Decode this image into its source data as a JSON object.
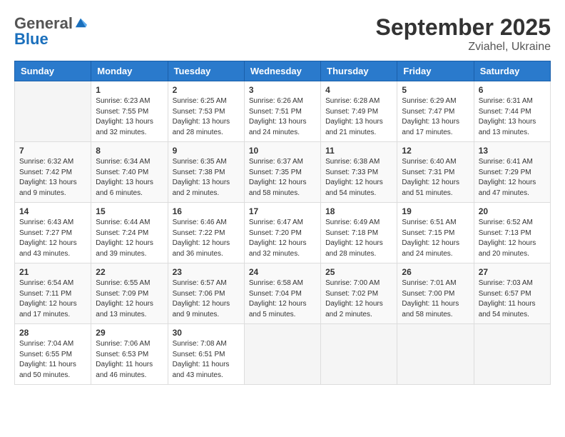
{
  "logo": {
    "general": "General",
    "blue": "Blue"
  },
  "title": "September 2025",
  "subtitle": "Zviahel, Ukraine",
  "weekdays": [
    "Sunday",
    "Monday",
    "Tuesday",
    "Wednesday",
    "Thursday",
    "Friday",
    "Saturday"
  ],
  "weeks": [
    [
      {
        "day": "",
        "info": ""
      },
      {
        "day": "1",
        "info": "Sunrise: 6:23 AM\nSunset: 7:55 PM\nDaylight: 13 hours and 32 minutes."
      },
      {
        "day": "2",
        "info": "Sunrise: 6:25 AM\nSunset: 7:53 PM\nDaylight: 13 hours and 28 minutes."
      },
      {
        "day": "3",
        "info": "Sunrise: 6:26 AM\nSunset: 7:51 PM\nDaylight: 13 hours and 24 minutes."
      },
      {
        "day": "4",
        "info": "Sunrise: 6:28 AM\nSunset: 7:49 PM\nDaylight: 13 hours and 21 minutes."
      },
      {
        "day": "5",
        "info": "Sunrise: 6:29 AM\nSunset: 7:47 PM\nDaylight: 13 hours and 17 minutes."
      },
      {
        "day": "6",
        "info": "Sunrise: 6:31 AM\nSunset: 7:44 PM\nDaylight: 13 hours and 13 minutes."
      }
    ],
    [
      {
        "day": "7",
        "info": "Sunrise: 6:32 AM\nSunset: 7:42 PM\nDaylight: 13 hours and 9 minutes."
      },
      {
        "day": "8",
        "info": "Sunrise: 6:34 AM\nSunset: 7:40 PM\nDaylight: 13 hours and 6 minutes."
      },
      {
        "day": "9",
        "info": "Sunrise: 6:35 AM\nSunset: 7:38 PM\nDaylight: 13 hours and 2 minutes."
      },
      {
        "day": "10",
        "info": "Sunrise: 6:37 AM\nSunset: 7:35 PM\nDaylight: 12 hours and 58 minutes."
      },
      {
        "day": "11",
        "info": "Sunrise: 6:38 AM\nSunset: 7:33 PM\nDaylight: 12 hours and 54 minutes."
      },
      {
        "day": "12",
        "info": "Sunrise: 6:40 AM\nSunset: 7:31 PM\nDaylight: 12 hours and 51 minutes."
      },
      {
        "day": "13",
        "info": "Sunrise: 6:41 AM\nSunset: 7:29 PM\nDaylight: 12 hours and 47 minutes."
      }
    ],
    [
      {
        "day": "14",
        "info": "Sunrise: 6:43 AM\nSunset: 7:27 PM\nDaylight: 12 hours and 43 minutes."
      },
      {
        "day": "15",
        "info": "Sunrise: 6:44 AM\nSunset: 7:24 PM\nDaylight: 12 hours and 39 minutes."
      },
      {
        "day": "16",
        "info": "Sunrise: 6:46 AM\nSunset: 7:22 PM\nDaylight: 12 hours and 36 minutes."
      },
      {
        "day": "17",
        "info": "Sunrise: 6:47 AM\nSunset: 7:20 PM\nDaylight: 12 hours and 32 minutes."
      },
      {
        "day": "18",
        "info": "Sunrise: 6:49 AM\nSunset: 7:18 PM\nDaylight: 12 hours and 28 minutes."
      },
      {
        "day": "19",
        "info": "Sunrise: 6:51 AM\nSunset: 7:15 PM\nDaylight: 12 hours and 24 minutes."
      },
      {
        "day": "20",
        "info": "Sunrise: 6:52 AM\nSunset: 7:13 PM\nDaylight: 12 hours and 20 minutes."
      }
    ],
    [
      {
        "day": "21",
        "info": "Sunrise: 6:54 AM\nSunset: 7:11 PM\nDaylight: 12 hours and 17 minutes."
      },
      {
        "day": "22",
        "info": "Sunrise: 6:55 AM\nSunset: 7:09 PM\nDaylight: 12 hours and 13 minutes."
      },
      {
        "day": "23",
        "info": "Sunrise: 6:57 AM\nSunset: 7:06 PM\nDaylight: 12 hours and 9 minutes."
      },
      {
        "day": "24",
        "info": "Sunrise: 6:58 AM\nSunset: 7:04 PM\nDaylight: 12 hours and 5 minutes."
      },
      {
        "day": "25",
        "info": "Sunrise: 7:00 AM\nSunset: 7:02 PM\nDaylight: 12 hours and 2 minutes."
      },
      {
        "day": "26",
        "info": "Sunrise: 7:01 AM\nSunset: 7:00 PM\nDaylight: 11 hours and 58 minutes."
      },
      {
        "day": "27",
        "info": "Sunrise: 7:03 AM\nSunset: 6:57 PM\nDaylight: 11 hours and 54 minutes."
      }
    ],
    [
      {
        "day": "28",
        "info": "Sunrise: 7:04 AM\nSunset: 6:55 PM\nDaylight: 11 hours and 50 minutes."
      },
      {
        "day": "29",
        "info": "Sunrise: 7:06 AM\nSunset: 6:53 PM\nDaylight: 11 hours and 46 minutes."
      },
      {
        "day": "30",
        "info": "Sunrise: 7:08 AM\nSunset: 6:51 PM\nDaylight: 11 hours and 43 minutes."
      },
      {
        "day": "",
        "info": ""
      },
      {
        "day": "",
        "info": ""
      },
      {
        "day": "",
        "info": ""
      },
      {
        "day": "",
        "info": ""
      }
    ]
  ]
}
